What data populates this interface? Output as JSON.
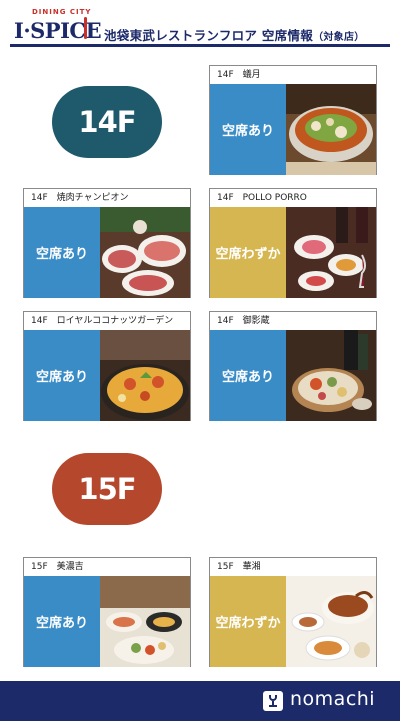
{
  "header": {
    "logo_arc": "DINING CITY",
    "logo_word": "I·SPICE",
    "title": "池袋東武レストランフロア 空席情報",
    "title_sub": "（対象店）"
  },
  "floors": [
    {
      "label": "14F",
      "color": "#1e5a6b"
    },
    {
      "label": "15F",
      "color": "#b4472c"
    }
  ],
  "restaurants": [
    {
      "name": "14F　蟻月",
      "status": "空席あり",
      "status_color": "#3a8cc7",
      "photo_icon": "motsunabe-hotpot-photo"
    },
    {
      "name": "14F　焼肉チャンピオン",
      "status": "空席あり",
      "status_color": "#3a8cc7",
      "photo_icon": "yakiniku-meat-photo"
    },
    {
      "name": "14F　POLLO PORRO",
      "status": "空席わずか",
      "status_color": "#d6b650",
      "photo_icon": "italian-wine-dishes-photo"
    },
    {
      "name": "14F　ロイヤルココナッツガーデン",
      "status": "空席あり",
      "status_color": "#3a8cc7",
      "photo_icon": "paella-photo"
    },
    {
      "name": "14F　御影蔵",
      "status": "空席あり",
      "status_color": "#3a8cc7",
      "photo_icon": "japanese-course-photo"
    },
    {
      "name": "15F　美濃吉",
      "status": "空席あり",
      "status_color": "#3a8cc7",
      "photo_icon": "kaiseki-photo"
    },
    {
      "name": "15F　華湘",
      "status": "空席わずか",
      "status_color": "#d6b650",
      "photo_icon": "peking-duck-photo"
    }
  ],
  "footer": {
    "brand": "nomachi",
    "icon": "wine-glass-icon"
  }
}
